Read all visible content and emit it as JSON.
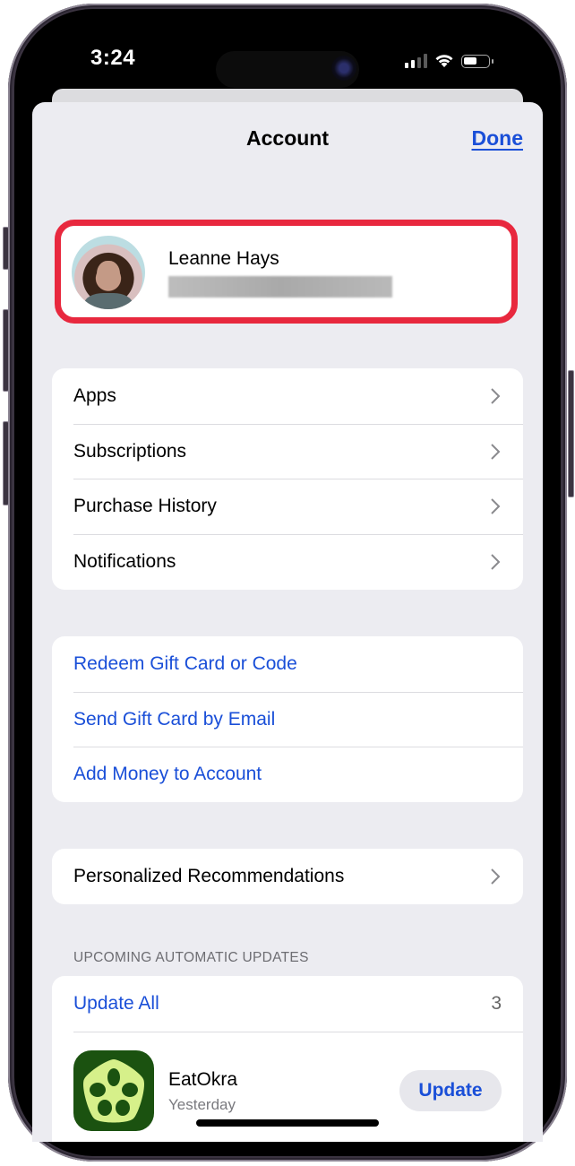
{
  "status_bar": {
    "time": "3:24",
    "signal_bars_filled": 2,
    "signal_bars_total": 4,
    "wifi": "wifi-icon",
    "battery_level": 0.55
  },
  "nav": {
    "title": "Account",
    "done_label": "Done"
  },
  "profile": {
    "name": "Leanne Hays",
    "email": "",
    "highlight_color": "#e8283e"
  },
  "account_group": {
    "items": [
      {
        "label": "Apps"
      },
      {
        "label": "Subscriptions"
      },
      {
        "label": "Purchase History"
      },
      {
        "label": "Notifications"
      }
    ]
  },
  "gift_group": {
    "items": [
      {
        "label": "Redeem Gift Card or Code"
      },
      {
        "label": "Send Gift Card by Email"
      },
      {
        "label": "Add Money to Account"
      }
    ]
  },
  "recommendations": {
    "label": "Personalized Recommendations"
  },
  "updates": {
    "section_header": "UPCOMING AUTOMATIC UPDATES",
    "update_all_label": "Update All",
    "count": "3",
    "apps": [
      {
        "name": "EatOkra",
        "date": "Yesterday",
        "button_label": "Update",
        "icon": "eatokra-app-icon"
      }
    ]
  },
  "colors": {
    "accent": "#1a4fd8",
    "background": "#ececf1",
    "highlight": "#e8283e"
  }
}
